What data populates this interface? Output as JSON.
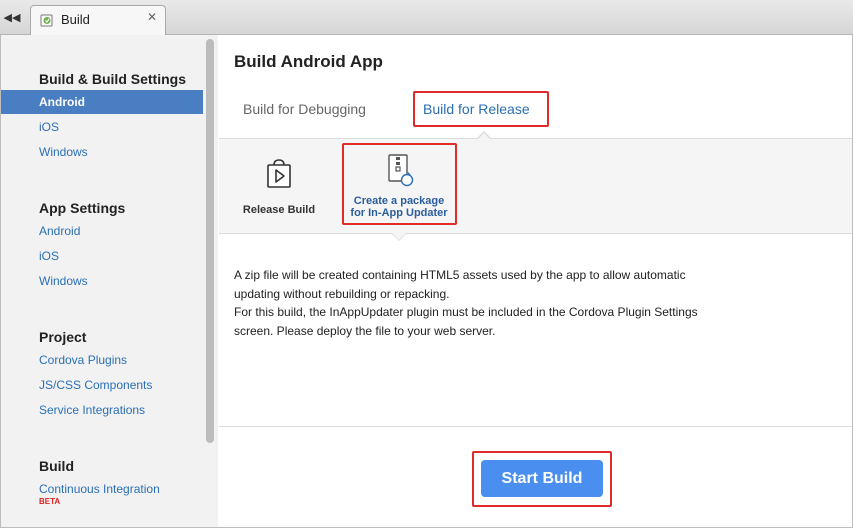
{
  "window": {
    "tab_title": "Build",
    "tab_close": "✕",
    "back_glyph": "◀◀"
  },
  "sidebar": {
    "sections": [
      {
        "heading": "Build & Build Settings",
        "items": [
          "Android",
          "iOS",
          "Windows"
        ],
        "active": "Android"
      },
      {
        "heading": "App Settings",
        "items": [
          "Android",
          "iOS",
          "Windows"
        ]
      },
      {
        "heading": "Project",
        "items": [
          "Cordova Plugins",
          "JS/CSS Components",
          "Service Integrations"
        ]
      },
      {
        "heading": "Build",
        "items": [
          "Continuous Integration"
        ],
        "badge": "BETA"
      }
    ]
  },
  "main": {
    "title": "Build Android App",
    "tabs": {
      "debug": "Build for Debugging",
      "release": "Build for Release"
    },
    "options": {
      "release_build": "Release Build",
      "package_line1": "Create a package",
      "package_line2": "for In-App Updater"
    },
    "description": {
      "line1": "A zip file will be created containing HTML5 assets used by the app to allow automatic",
      "line2": "updating without rebuilding or repacking.",
      "line3": "For this build, the InAppUpdater plugin must be included in the Cordova Plugin Settings",
      "line4": "screen. Please deploy the file to your web server."
    },
    "start_button": "Start Build"
  },
  "colors": {
    "accent": "#4a7ec3",
    "link": "#2b6fb5",
    "highlight_border": "#e02b2b",
    "button": "#4a8ff0"
  }
}
